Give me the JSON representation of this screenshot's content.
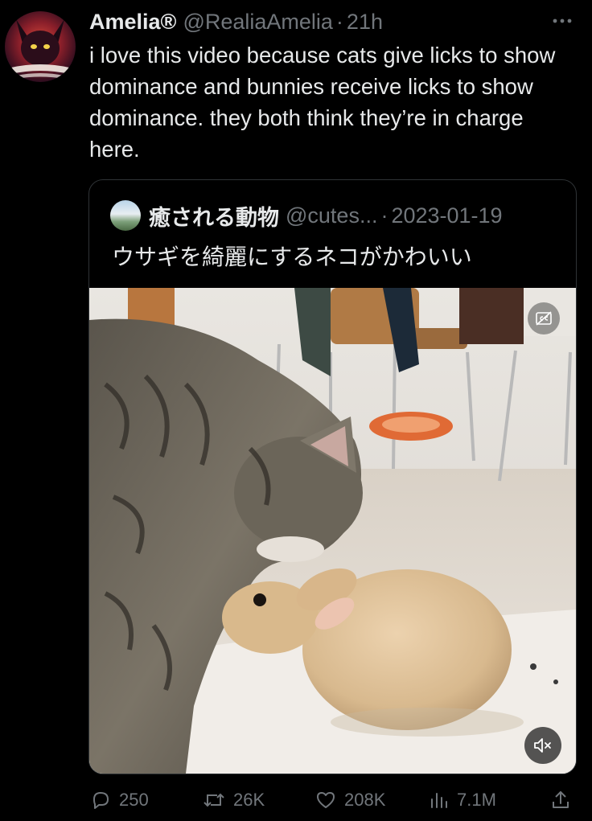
{
  "tweet": {
    "display_name": "Amelia®",
    "handle": "@RealiaAmelia",
    "separator": "·",
    "time": "21h",
    "text": "i love this video because cats give licks to show dominance and bunnies receive licks to show dominance. they both think they’re in charge here.",
    "avatar_icon": "user-avatar",
    "more_icon": "more-horizontal-icon"
  },
  "quote": {
    "name": "癒される動物",
    "handle": "@cutes...",
    "separator": "·",
    "date": "2023-01-19",
    "text": "ウサギを綺麗にするネコがかわいい",
    "media": {
      "type": "video",
      "cc_icon": "closed-captions-icon",
      "mute_icon": "volume-muted-icon"
    }
  },
  "actions": {
    "reply_count": "250",
    "retweet_count": "26K",
    "like_count": "208K",
    "view_count": "7.1M"
  },
  "colors": {
    "background": "#000000",
    "text_primary": "#e7e9ea",
    "text_secondary": "#71767b",
    "border": "#2f3336"
  }
}
